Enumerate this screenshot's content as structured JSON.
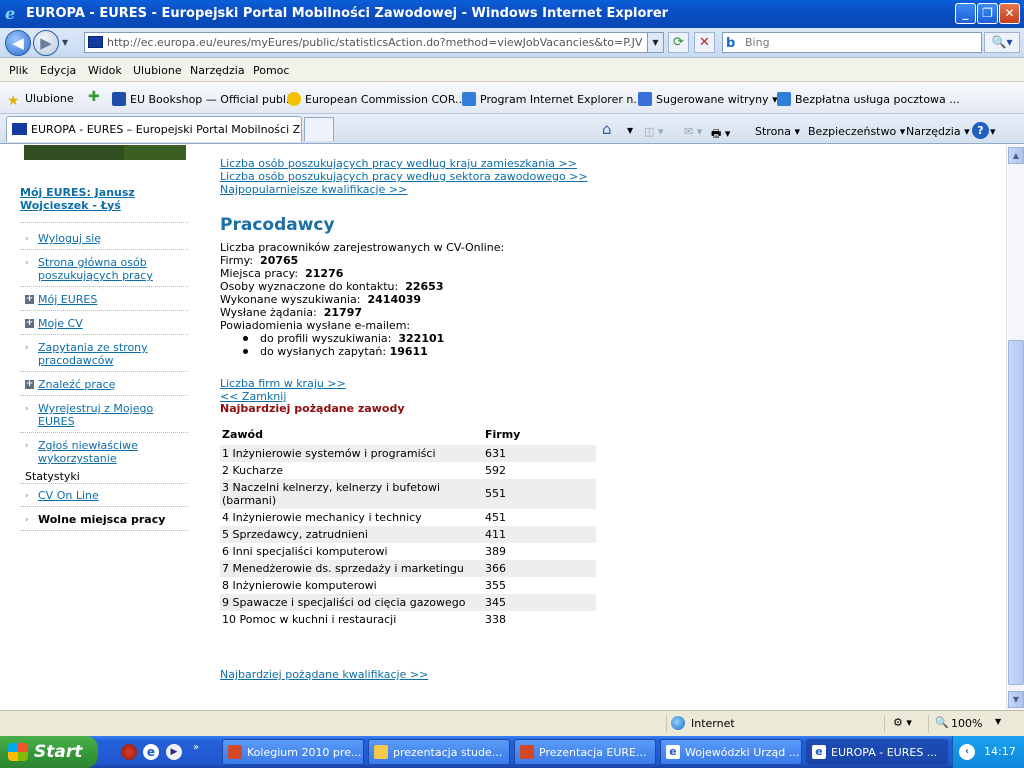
{
  "window": {
    "title": "EUROPA - EURES - Europejski Portal Mobilności Zawodowej - Windows Internet Explorer"
  },
  "address": {
    "url": "http://ec.europa.eu/eures/myEures/public/statisticsAction.do?method=viewJobVacancies&to=P.JV"
  },
  "search": {
    "placeholder": "Bing"
  },
  "menu": [
    "Plik",
    "Edycja",
    "Widok",
    "Ulubione",
    "Narzędzia",
    "Pomoc"
  ],
  "favorites": {
    "label": "Ulubione",
    "items": [
      "EU Bookshop — Official publ...",
      "European Commission COR...",
      "Program Internet Explorer n...",
      "Sugerowane witryny",
      "Bezpłatna usługa pocztowa ..."
    ]
  },
  "tab": {
    "title": "EUROPA - EURES – Europejski Portal Mobilności Zawo..."
  },
  "toolbar": {
    "page": "Strona",
    "safety": "Bezpieczeństwo",
    "tools": "Narzędzia"
  },
  "sidebar": {
    "user": "Mój EURES: Janusz Wojcieszek - Łyś",
    "items": [
      {
        "label": "Wyloguj się"
      },
      {
        "label": "Strona główna osób poszukujących pracy"
      },
      {
        "label": "Mój EURES"
      },
      {
        "label": "Moje CV"
      },
      {
        "label": "Zapytania ze strony pracodawców"
      },
      {
        "label": "Znaleźć pracę"
      },
      {
        "label": "Wyrejestruj z Mojego EURES"
      },
      {
        "label": "Zgłoś niewłaściwe wykorzystanie"
      }
    ],
    "stats_label": "Statystyki",
    "stats_items": [
      {
        "label": "CV On Line"
      },
      {
        "label": "Wolne miejsca pracy"
      }
    ]
  },
  "main": {
    "top_links": [
      "Liczba osób poszukujących pracy według kraju zamieszkania >>",
      "Liczba osób poszukujących pracy według sektora zawodowego >>",
      "Najpopularniejsze kwalifikacje >>"
    ],
    "employers_heading": "Pracodawcy",
    "cv_label": "Liczba pracowników zarejestrowanych w CV-Online:",
    "stats": [
      {
        "label": "Firmy:",
        "value": "20765"
      },
      {
        "label": "Miejsca pracy:",
        "value": "21276"
      },
      {
        "label": "Osoby wyznaczone do kontaktu:",
        "value": "22653"
      },
      {
        "label": "Wykonane wyszukiwania:",
        "value": "2414039"
      },
      {
        "label": "Wysłane żądania:",
        "value": "21797"
      }
    ],
    "notifications_label": "Powiadomienia wysłane e-mailem:",
    "notifications": [
      {
        "label": "do profili wyszukiwania:",
        "value": "322101"
      },
      {
        "label": "do wysłanych zapytań:",
        "value": "19611"
      }
    ],
    "firms_link": "Liczba firm w kraju >>",
    "close_link": "<< Zamknij",
    "occupations_heading": "Najbardziej pożądane zawody",
    "table": {
      "headers": [
        "Zawód",
        "Firmy"
      ],
      "rows": [
        {
          "name": "1  Inżynierowie systemów i programiści",
          "count": "631"
        },
        {
          "name": "2  Kucharze",
          "count": "592"
        },
        {
          "name": "3  Naczelni kelnerzy, kelnerzy i bufetowi (barmani)",
          "count": "551"
        },
        {
          "name": "4  Inżynierowie mechanicy i technicy",
          "count": "451"
        },
        {
          "name": "5  Sprzedawcy, zatrudnieni",
          "count": "411"
        },
        {
          "name": "6  Inni specjaliści komputerowi",
          "count": "389"
        },
        {
          "name": "7  Menedżerowie ds. sprzedaży i marketingu",
          "count": "366"
        },
        {
          "name": "8  Inżynierowie komputerowi",
          "count": "355"
        },
        {
          "name": "9  Spawacze i specjaliści od cięcia gazowego",
          "count": "345"
        },
        {
          "name": "10  Pomoc w kuchni i restauracji",
          "count": "338"
        }
      ]
    },
    "bottom_link": "Najbardziej pożądane kwalifikacje >>"
  },
  "status": {
    "zone": "Internet",
    "zoom": "100%"
  },
  "taskbar": {
    "start": "Start",
    "tasks": [
      "Kolegium 2010 pre...",
      "prezentacja stude...",
      "Prezentacja EURE...",
      "Wojewódzki Urząd ...",
      "EUROPA - EURES ..."
    ],
    "clock": "14:17"
  },
  "colors": {
    "link": "#0d6ea8",
    "heading": "#1a6fa5",
    "occupations_heading": "#8b0d0d",
    "titlebar": "#0b4fc4"
  }
}
